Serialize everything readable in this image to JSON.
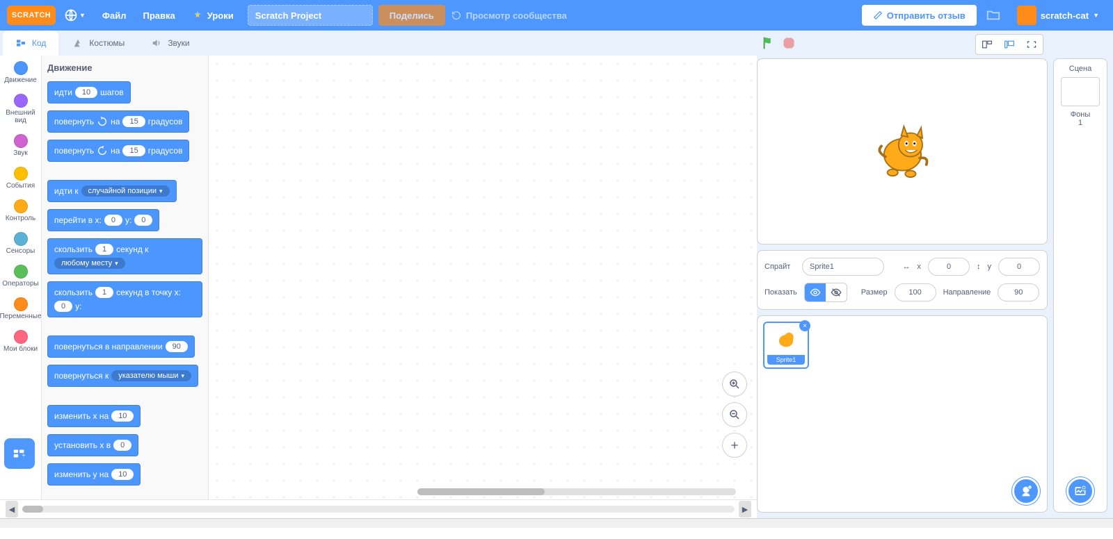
{
  "menubar": {
    "logo": "SCRATCH",
    "file": "Файл",
    "edit": "Правка",
    "tutorials": "Уроки",
    "project_title": "Scratch Project",
    "share": "Поделись",
    "see_community": "Просмотр сообщества",
    "feedback": "Отправить отзыв",
    "username": "scratch-cat"
  },
  "tabs": {
    "code": "Код",
    "costumes": "Костюмы",
    "sounds": "Звуки"
  },
  "categories": [
    {
      "name": "Движение",
      "color": "#4c97ff"
    },
    {
      "name": "Внешний вид",
      "color": "#9966ff"
    },
    {
      "name": "Звук",
      "color": "#cf63cf"
    },
    {
      "name": "События",
      "color": "#ffbf00"
    },
    {
      "name": "Контроль",
      "color": "#ffab19"
    },
    {
      "name": "Сенсоры",
      "color": "#5cb1d6"
    },
    {
      "name": "Операторы",
      "color": "#59c059"
    },
    {
      "name": "Переменные",
      "color": "#ff8c1a"
    },
    {
      "name": "Мои блоки",
      "color": "#ff6680"
    }
  ],
  "palette": {
    "header": "Движение",
    "blocks": [
      {
        "type": "simple",
        "parts": [
          {
            "t": "идти"
          },
          {
            "oval": "10"
          },
          {
            "t": "шагов"
          }
        ]
      },
      {
        "type": "simple",
        "parts": [
          {
            "t": "повернуть"
          },
          {
            "icon": "cw"
          },
          {
            "t": "на"
          },
          {
            "oval": "15"
          },
          {
            "t": "градусов"
          }
        ]
      },
      {
        "type": "simple",
        "parts": [
          {
            "t": "повернуть"
          },
          {
            "icon": "ccw"
          },
          {
            "t": "на"
          },
          {
            "oval": "15"
          },
          {
            "t": "градусов"
          }
        ]
      },
      {
        "type": "gap"
      },
      {
        "type": "simple",
        "parts": [
          {
            "t": "идти к"
          },
          {
            "dd": "случайной позиции"
          }
        ]
      },
      {
        "type": "simple",
        "parts": [
          {
            "t": "перейти в x:"
          },
          {
            "oval": "0"
          },
          {
            "t": "y:"
          },
          {
            "oval": "0"
          }
        ]
      },
      {
        "type": "simple",
        "parts": [
          {
            "t": "скользить"
          },
          {
            "oval": "1"
          },
          {
            "t": "секунд к"
          },
          {
            "dd": "любому месту"
          }
        ]
      },
      {
        "type": "simple",
        "parts": [
          {
            "t": "скользить"
          },
          {
            "oval": "1"
          },
          {
            "t": "секунд в точку x:"
          },
          {
            "oval": "0"
          },
          {
            "t": "y:"
          }
        ]
      },
      {
        "type": "gap"
      },
      {
        "type": "simple",
        "parts": [
          {
            "t": "повернуться в направлении"
          },
          {
            "oval": "90"
          }
        ]
      },
      {
        "type": "simple",
        "parts": [
          {
            "t": "повернуться к"
          },
          {
            "dd": "указателю мыши"
          }
        ]
      },
      {
        "type": "gap"
      },
      {
        "type": "simple",
        "parts": [
          {
            "t": "изменить x на"
          },
          {
            "oval": "10"
          }
        ]
      },
      {
        "type": "simple",
        "parts": [
          {
            "t": "установить x в"
          },
          {
            "oval": "0"
          }
        ]
      },
      {
        "type": "simple",
        "parts": [
          {
            "t": "изменить y на"
          },
          {
            "oval": "10"
          }
        ]
      }
    ]
  },
  "sprite_info": {
    "sprite_label": "Спрайт",
    "sprite_name": "Sprite1",
    "x_label": "x",
    "x_value": "0",
    "y_label": "y",
    "y_value": "0",
    "show_label": "Показать",
    "size_label": "Размер",
    "size_value": "100",
    "direction_label": "Направление",
    "direction_value": "90"
  },
  "sprite_tile": {
    "name": "Sprite1"
  },
  "stage_selector": {
    "title": "Сцена",
    "backdrops_label": "Фоны",
    "backdrops_count": "1"
  }
}
